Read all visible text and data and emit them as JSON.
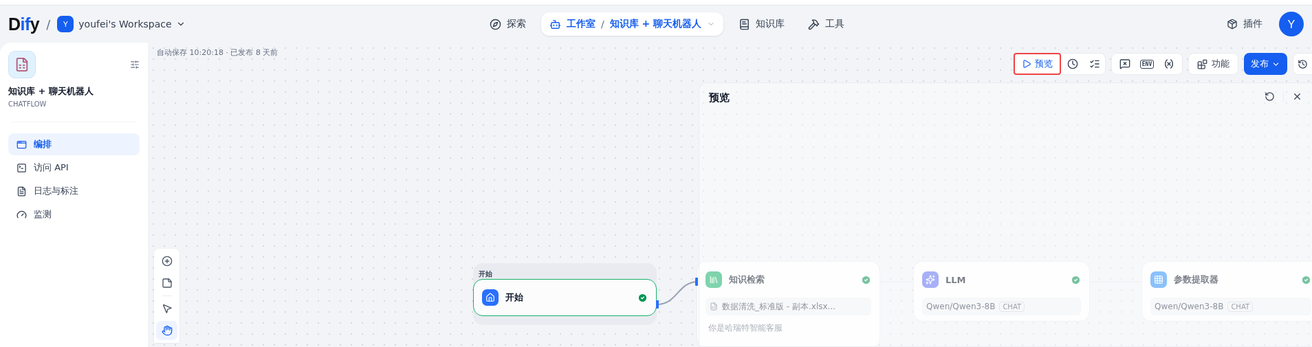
{
  "header": {
    "logo_a": "D",
    "logo_b": "if",
    "logo_c": "y",
    "separator": "/",
    "workspace": {
      "avatar": "Y",
      "name": "youfei's Workspace"
    },
    "nav": [
      {
        "label": "探索",
        "selected": false
      },
      {
        "label": "工作室",
        "selected": true,
        "sub": "知识库 + 聊天机器人"
      },
      {
        "label": "知识库",
        "selected": false
      },
      {
        "label": "工具",
        "selected": false
      }
    ],
    "plugins": "插件",
    "user_avatar": "Y"
  },
  "sidebar": {
    "app_name": "知识库 + 聊天机器人",
    "app_type": "CHATFLOW",
    "items": [
      {
        "label": "编排",
        "selected": true
      },
      {
        "label": "访问 API",
        "selected": false
      },
      {
        "label": "日志与标注",
        "selected": false
      },
      {
        "label": "监测",
        "selected": false
      }
    ]
  },
  "canvas": {
    "status": "自动保存 10:20:18 · 已发布 8 天前",
    "toolbar": {
      "preview": "预览",
      "preview_highlighted": true,
      "env": "ENV",
      "features": "功能",
      "publish": "发布"
    },
    "tools": [
      {
        "kind": "add",
        "selected": false
      },
      {
        "kind": "note",
        "selected": false
      },
      {
        "kind": "pointer",
        "selected": false
      },
      {
        "kind": "hand",
        "selected": true
      }
    ],
    "nodes": [
      {
        "kind": "start",
        "group_label": "开始",
        "title": "开始",
        "done": true
      },
      {
        "kind": "knowledge",
        "title": "知识检索",
        "done": true,
        "dataset": "数据清洗_标准版 - 副本.xlsx...",
        "prompt": "你是哈瑞特智能客服"
      },
      {
        "kind": "llm",
        "title": "LLM",
        "done": true,
        "model": "Qwen/Qwen3-8B",
        "badge": "CHAT"
      },
      {
        "kind": "extractor",
        "title": "参数提取器",
        "done": true,
        "model": "Qwen/Qwen3-8B",
        "badge": "CHAT"
      }
    ]
  },
  "preview_panel": {
    "title": "预览"
  }
}
